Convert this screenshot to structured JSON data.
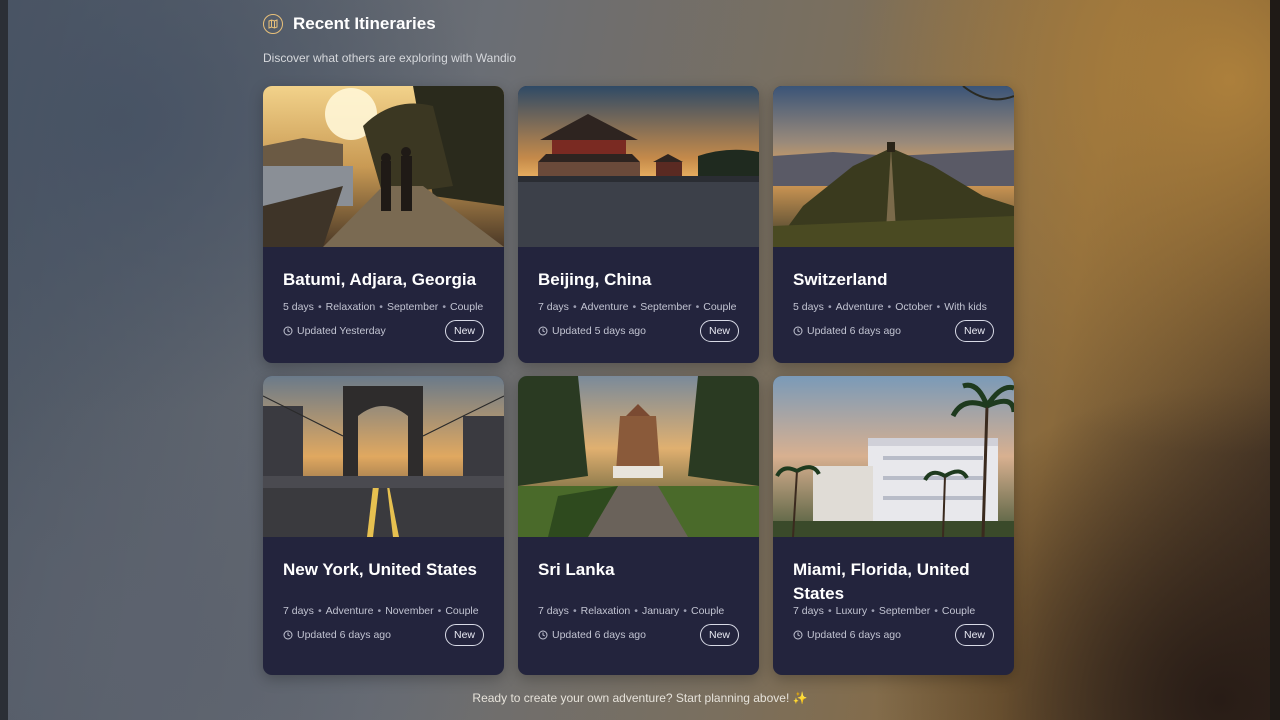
{
  "header": {
    "title": "Recent Itineraries",
    "icon": "map-icon",
    "subtitle": "Discover what others are exploring with Wandio"
  },
  "cards": [
    {
      "title": "Batumi, Adjara, Georgia",
      "days": "5 days",
      "style": "Relaxation",
      "month": "September",
      "group": "Couple",
      "updated": "Updated Yesterday",
      "badge": "New",
      "image": "seaside-promenade-sunset-couple"
    },
    {
      "title": "Beijing, China",
      "days": "7 days",
      "style": "Adventure",
      "month": "September",
      "group": "Couple",
      "updated": "Updated 5 days ago",
      "badge": "New",
      "image": "chinese-palace-dusk"
    },
    {
      "title": "Switzerland",
      "days": "5 days",
      "style": "Adventure",
      "month": "October",
      "group": "With kids",
      "updated": "Updated 6 days ago",
      "badge": "New",
      "image": "hilltop-castle-sunset"
    },
    {
      "title": "New York, United States",
      "days": "7 days",
      "style": "Adventure",
      "month": "November",
      "group": "Couple",
      "updated": "Updated 6 days ago",
      "badge": "New",
      "image": "suspension-bridge-road-dusk"
    },
    {
      "title": "Sri Lanka",
      "days": "7 days",
      "style": "Relaxation",
      "month": "January",
      "group": "Couple",
      "updated": "Updated 6 days ago",
      "badge": "New",
      "image": "temple-garden-path"
    },
    {
      "title": "Miami, Florida, United States",
      "days": "7 days",
      "style": "Luxury",
      "month": "September",
      "group": "Couple",
      "updated": "Updated 6 days ago",
      "badge": "New",
      "image": "art-deco-hotel-palms"
    }
  ],
  "footer": {
    "text": "Ready to create your own adventure? Start planning above! ✨"
  },
  "colors": {
    "card_bg": "#23243d",
    "accent": "#e8c07a"
  }
}
